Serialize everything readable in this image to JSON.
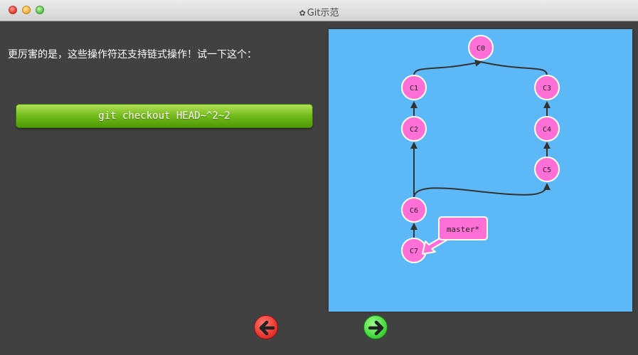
{
  "window": {
    "title": "Git示范",
    "title_icon": "gear-icon"
  },
  "main": {
    "instruction": "更厉害的是，这些操作符还支持链式操作！试一下这个：",
    "command_label": "git checkout HEAD~^2~2"
  },
  "graph": {
    "commits": [
      "C0",
      "C1",
      "C2",
      "C3",
      "C4",
      "C5",
      "C6",
      "C7"
    ],
    "branch_label": "master*",
    "colors": {
      "background": "#5cb8f6",
      "node": "#ff6fd5",
      "edge": "#333333"
    }
  },
  "nav": {
    "back_icon": "arrow-left-icon",
    "forward_icon": "arrow-right-icon"
  }
}
